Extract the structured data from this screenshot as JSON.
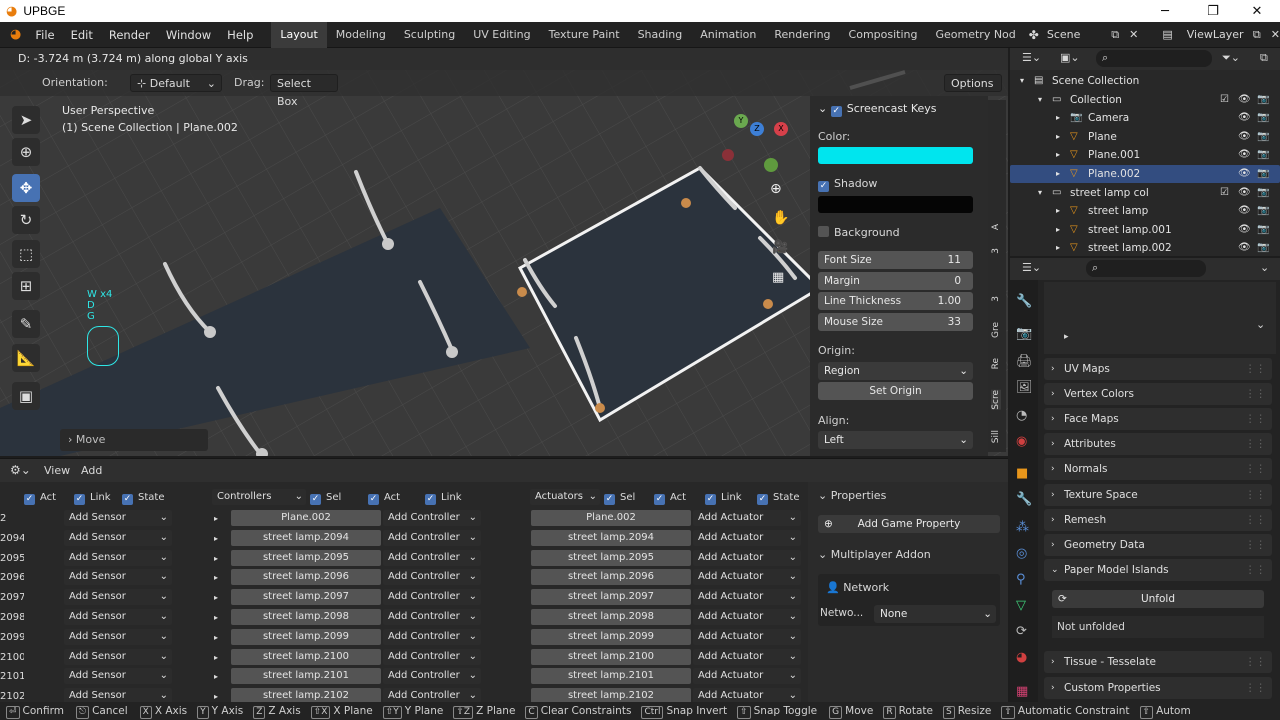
{
  "window": {
    "title": "UPBGE",
    "minimize": "─",
    "maximize": "❐",
    "close": "✕"
  },
  "menu": [
    "File",
    "Edit",
    "Render",
    "Window",
    "Help"
  ],
  "workspaces": [
    "Layout",
    "Modeling",
    "Sculpting",
    "UV Editing",
    "Texture Paint",
    "Shading",
    "Animation",
    "Rendering",
    "Compositing",
    "Geometry Nod"
  ],
  "active_workspace": "Layout",
  "scene": "Scene",
  "view_layer": "ViewLayer",
  "viewport": {
    "status": "D: -3.724 m (3.724 m) along global Y axis",
    "orientation_label": "Orientation:",
    "orientation_value": "Default",
    "drag_label": "Drag:",
    "drag_value": "Select Box",
    "options": "Options",
    "perspective": "User Perspective",
    "collection_info": "(1) Scene Collection | Plane.002",
    "keys_overlay": [
      "W x4",
      "D",
      "G"
    ],
    "last_op": "Move",
    "side_tabs": [
      "A",
      "3",
      "3",
      "Gre",
      "Re",
      "Scre",
      "Sill"
    ]
  },
  "screencast": {
    "header": "Screencast Keys",
    "color_label": "Color:",
    "color": "#00e5ee",
    "shadow": "Shadow",
    "background": "Background",
    "font_size_label": "Font Size",
    "font_size": "11",
    "margin_label": "Margin",
    "margin": "0",
    "line_thickness_label": "Line Thickness",
    "line_thickness": "1.00",
    "mouse_size_label": "Mouse Size",
    "mouse_size": "33",
    "origin_label": "Origin:",
    "origin": "Region",
    "set_origin": "Set Origin",
    "align_label": "Align:",
    "align": "Left"
  },
  "logic": {
    "header": {
      "view": "View",
      "add": "Add"
    },
    "sensors_header": {
      "act": "Act",
      "link": "Link",
      "state": "State"
    },
    "controllers_header": {
      "title": "Controllers",
      "sel": "Sel",
      "act": "Act",
      "link": "Link"
    },
    "actuators_header": {
      "title": "Actuators",
      "sel": "Sel",
      "act": "Act",
      "link": "Link",
      "state": "State"
    },
    "sensor_ids": [
      "2",
      "2094",
      "2095",
      "2096",
      "2097",
      "2098",
      "2099",
      "2100",
      "2101",
      "2102"
    ],
    "objects": [
      "Plane.002",
      "street lamp.2094",
      "street lamp.2095",
      "street lamp.2096",
      "street lamp.2097",
      "street lamp.2098",
      "street lamp.2099",
      "street lamp.2100",
      "street lamp.2101",
      "street lamp.2102"
    ],
    "add_sensor": "Add Sensor",
    "add_controller": "Add Controller",
    "add_actuator": "Add Actuator",
    "properties": "Properties",
    "add_game_property": "Add Game Property",
    "multiplayer": "Multiplayer Addon",
    "network": "Network",
    "network_label": "Netwo...",
    "network_value": "None"
  },
  "outliner": {
    "search": "",
    "items": [
      {
        "label": "Scene Collection",
        "indent": 0
      },
      {
        "label": "Collection",
        "indent": 1
      },
      {
        "label": "Camera",
        "indent": 2
      },
      {
        "label": "Plane",
        "indent": 2
      },
      {
        "label": "Plane.001",
        "indent": 2
      },
      {
        "label": "Plane.002",
        "indent": 2,
        "selected": true
      },
      {
        "label": "street lamp col",
        "indent": 1
      },
      {
        "label": "street lamp",
        "indent": 2
      },
      {
        "label": "street lamp.001",
        "indent": 2
      },
      {
        "label": "street lamp.002",
        "indent": 2
      }
    ]
  },
  "properties": {
    "sections": [
      "UV Maps",
      "Vertex Colors",
      "Face Maps",
      "Attributes",
      "Normals",
      "Texture Space",
      "Remesh",
      "Geometry Data",
      "Paper Model Islands",
      "Tissue - Tesselate",
      "Custom Properties"
    ],
    "unfold": "Unfold",
    "not_unfolded": "Not unfolded"
  },
  "statusbar": [
    {
      "key": "⏎",
      "label": "Confirm"
    },
    {
      "key": "⎋",
      "label": "Cancel"
    },
    {
      "key": "X",
      "label": "X Axis"
    },
    {
      "key": "Y",
      "label": "Y Axis"
    },
    {
      "key": "Z",
      "label": "Z Axis"
    },
    {
      "key": "⇧X",
      "label": "X Plane"
    },
    {
      "key": "⇧Y",
      "label": "Y Plane"
    },
    {
      "key": "⇧Z",
      "label": "Z Plane"
    },
    {
      "key": "C",
      "label": "Clear Constraints"
    },
    {
      "key": "Ctrl",
      "label": "Snap Invert"
    },
    {
      "key": "⇧",
      "label": "Snap Toggle"
    },
    {
      "key": "G",
      "label": "Move"
    },
    {
      "key": "R",
      "label": "Rotate"
    },
    {
      "key": "S",
      "label": "Resize"
    },
    {
      "key": "⇧",
      "label": "Automatic Constraint"
    },
    {
      "key": "⇧",
      "label": "Autom"
    }
  ],
  "colors": {
    "accent": "#4772b3",
    "selected_row": "#334d80",
    "cyan": "#00e5ee"
  }
}
